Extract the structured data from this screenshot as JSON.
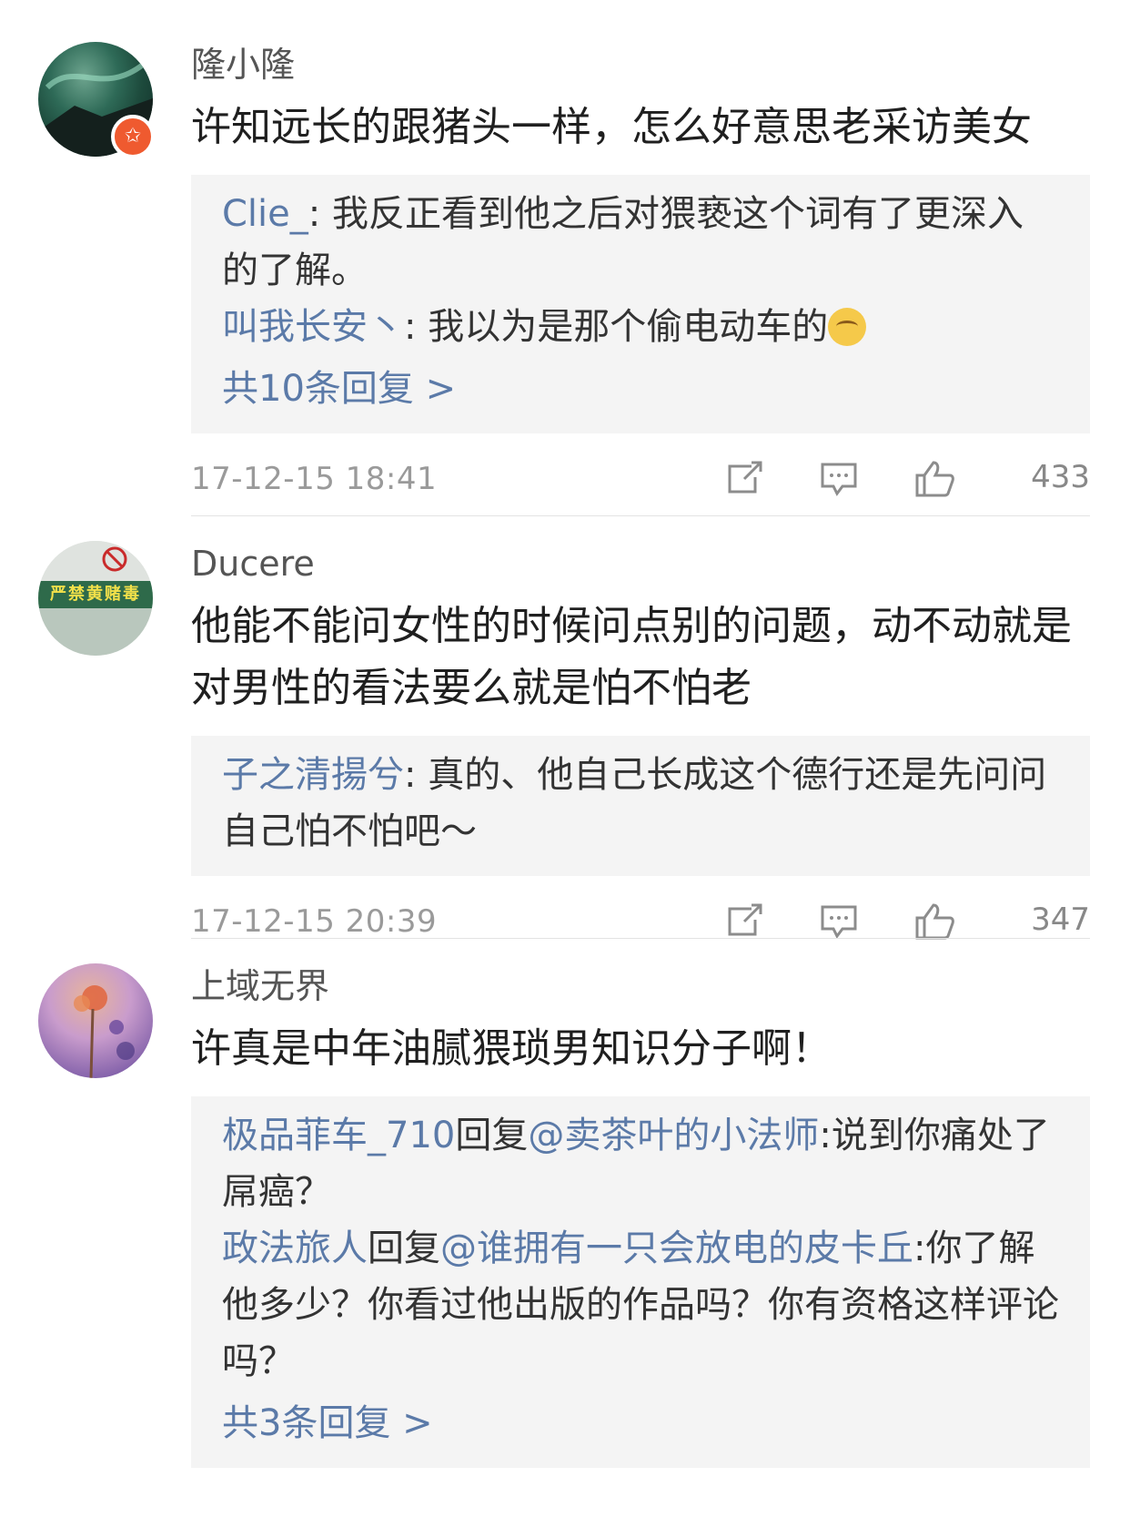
{
  "comments": [
    {
      "username": "隆小隆",
      "text": "许知远长的跟猪头一样，怎么好意思老采访美女",
      "replies": [
        {
          "name": "Clie_",
          "text": ": 我反正看到他之后对猥亵这个词有了更深入的了解。"
        },
        {
          "name": "叫我长安丶",
          "text": ": 我以为是那个偷电动车的",
          "emoji": "tired-face-emoji"
        }
      ],
      "more_replies": "共10条回复 >",
      "time": "17-12-15 18:41",
      "likes": "433",
      "avatar_colors": [
        "#1d4a3c",
        "#6ea58f",
        "#0f2a26"
      ],
      "avatar_badge": "star-badge-icon"
    },
    {
      "username": "Ducere",
      "text": "他能不能问女性的时候问点别的问题，动不动就是对男性的看法要么就是怕不怕老",
      "replies": [
        {
          "name": "子之清揚兮",
          "text": ": 真的、他自己长成这个德行还是先问问自己怕不怕吧～"
        }
      ],
      "more_replies": "",
      "time": "17-12-15 20:39",
      "likes": "347",
      "avatar_sign": "严禁黄赌毒",
      "avatar_colors": [
        "#2e6a4a",
        "#e9ebe8",
        "#c92b2b"
      ]
    },
    {
      "username": "上域无界",
      "text": "许真是中年油腻猥琐男知识分子啊！",
      "replies": [
        {
          "name": "极品菲车_710",
          "mid": "回复",
          "at": "@卖茶叶的小法师",
          "text": ":说到你痛处了屌癌？"
        },
        {
          "name": "政法旅人",
          "mid": "回复",
          "at": "@谁拥有一只会放电的皮卡丘",
          "text": ":你了解他多少？你看过他出版的作品吗？你有资格这样评论吗？"
        }
      ],
      "more_replies": "共3条回复 >",
      "avatar_colors": [
        "#b89ac9",
        "#e8b59a",
        "#7a5aa6"
      ]
    }
  ],
  "icons": {
    "share": "share-icon",
    "comment": "comment-icon",
    "like": "thumbs-up-icon"
  },
  "colors": {
    "link": "#5b7aa8",
    "reply_bg": "#f4f4f4",
    "meta": "#9a9a9a"
  }
}
